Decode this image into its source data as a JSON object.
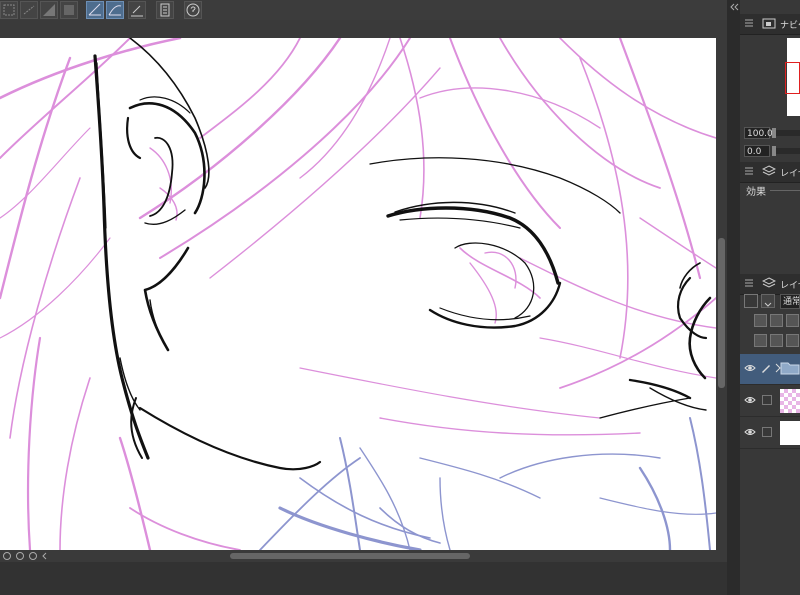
{
  "panels": {
    "navigator": {
      "tab_label": "ナビゲ"
    },
    "zoom": {
      "value": "100.0"
    },
    "rotate": {
      "value": "0.0"
    },
    "layer_property": {
      "tab_label": "レイヤ",
      "effect_label": "効果"
    },
    "layers": {
      "tab_label": "レイヤ",
      "blend_mode": "通常"
    }
  },
  "colors": {
    "sketch_pink": "#dc8fdb",
    "sketch_blue": "#8d95cf",
    "lineart": "#111111",
    "selected_layer": "#425c7c"
  },
  "layer_list": [
    {
      "type": "folder",
      "selected": true
    },
    {
      "type": "raster",
      "selected": false
    },
    {
      "type": "paper",
      "selected": false
    }
  ]
}
